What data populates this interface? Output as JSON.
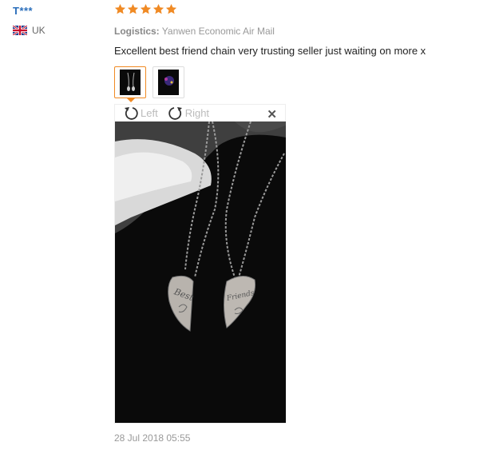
{
  "reviewer": {
    "name": "T***",
    "country_code": "UK",
    "flag_icon": "uk-flag-icon"
  },
  "review": {
    "rating": 5,
    "star_color": "#f08a24",
    "logistics_label": "Logistics:",
    "logistics_value": "Yanwen Economic Air Mail",
    "text": "Excellent best friend chain very trusting seller just waiting on more x",
    "date": "28 Jul 2018 05:55"
  },
  "viewer": {
    "rotate_left_label": "Left",
    "rotate_right_label": "Right",
    "close_icon": "close-icon",
    "pendant_left_text": "Best",
    "pendant_right_text": "Friends"
  },
  "thumbnails": [
    {
      "name": "photo-thumbnail-1",
      "selected": true
    },
    {
      "name": "photo-thumbnail-2",
      "selected": false
    }
  ]
}
